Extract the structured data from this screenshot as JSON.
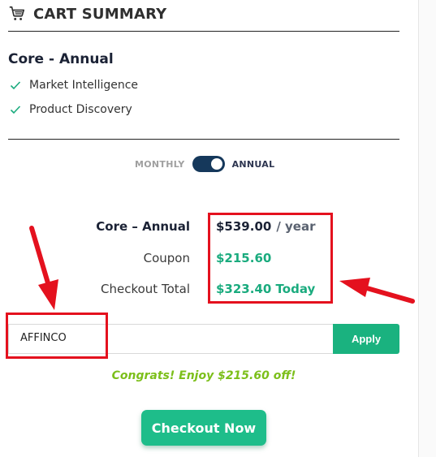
{
  "header": {
    "title": "CART SUMMARY",
    "icon": "shopping-cart-icon"
  },
  "plan": {
    "name": "Core - Annual",
    "features": [
      "Market Intelligence",
      "Product Discovery"
    ]
  },
  "billing_toggle": {
    "left_label": "MONTHLY",
    "right_label": "ANNUAL",
    "selected": "ANNUAL"
  },
  "summary": {
    "plan_label": "Core – Annual",
    "plan_price": "$539.00",
    "plan_period": "/ year",
    "coupon_label": "Coupon",
    "coupon_value": "$215.60",
    "total_label": "Checkout Total",
    "total_value": "$323.40 Today"
  },
  "coupon_field": {
    "value": "AFFINCO",
    "apply_label": "Apply"
  },
  "message": "Congrats! Enjoy $215.60 off!",
  "checkout_label": "Checkout Now",
  "colors": {
    "accent_green": "#1ab27f",
    "toggle_navy": "#15385b",
    "annotation_red": "#e4111e",
    "congrats_green": "#7cbf1a"
  }
}
